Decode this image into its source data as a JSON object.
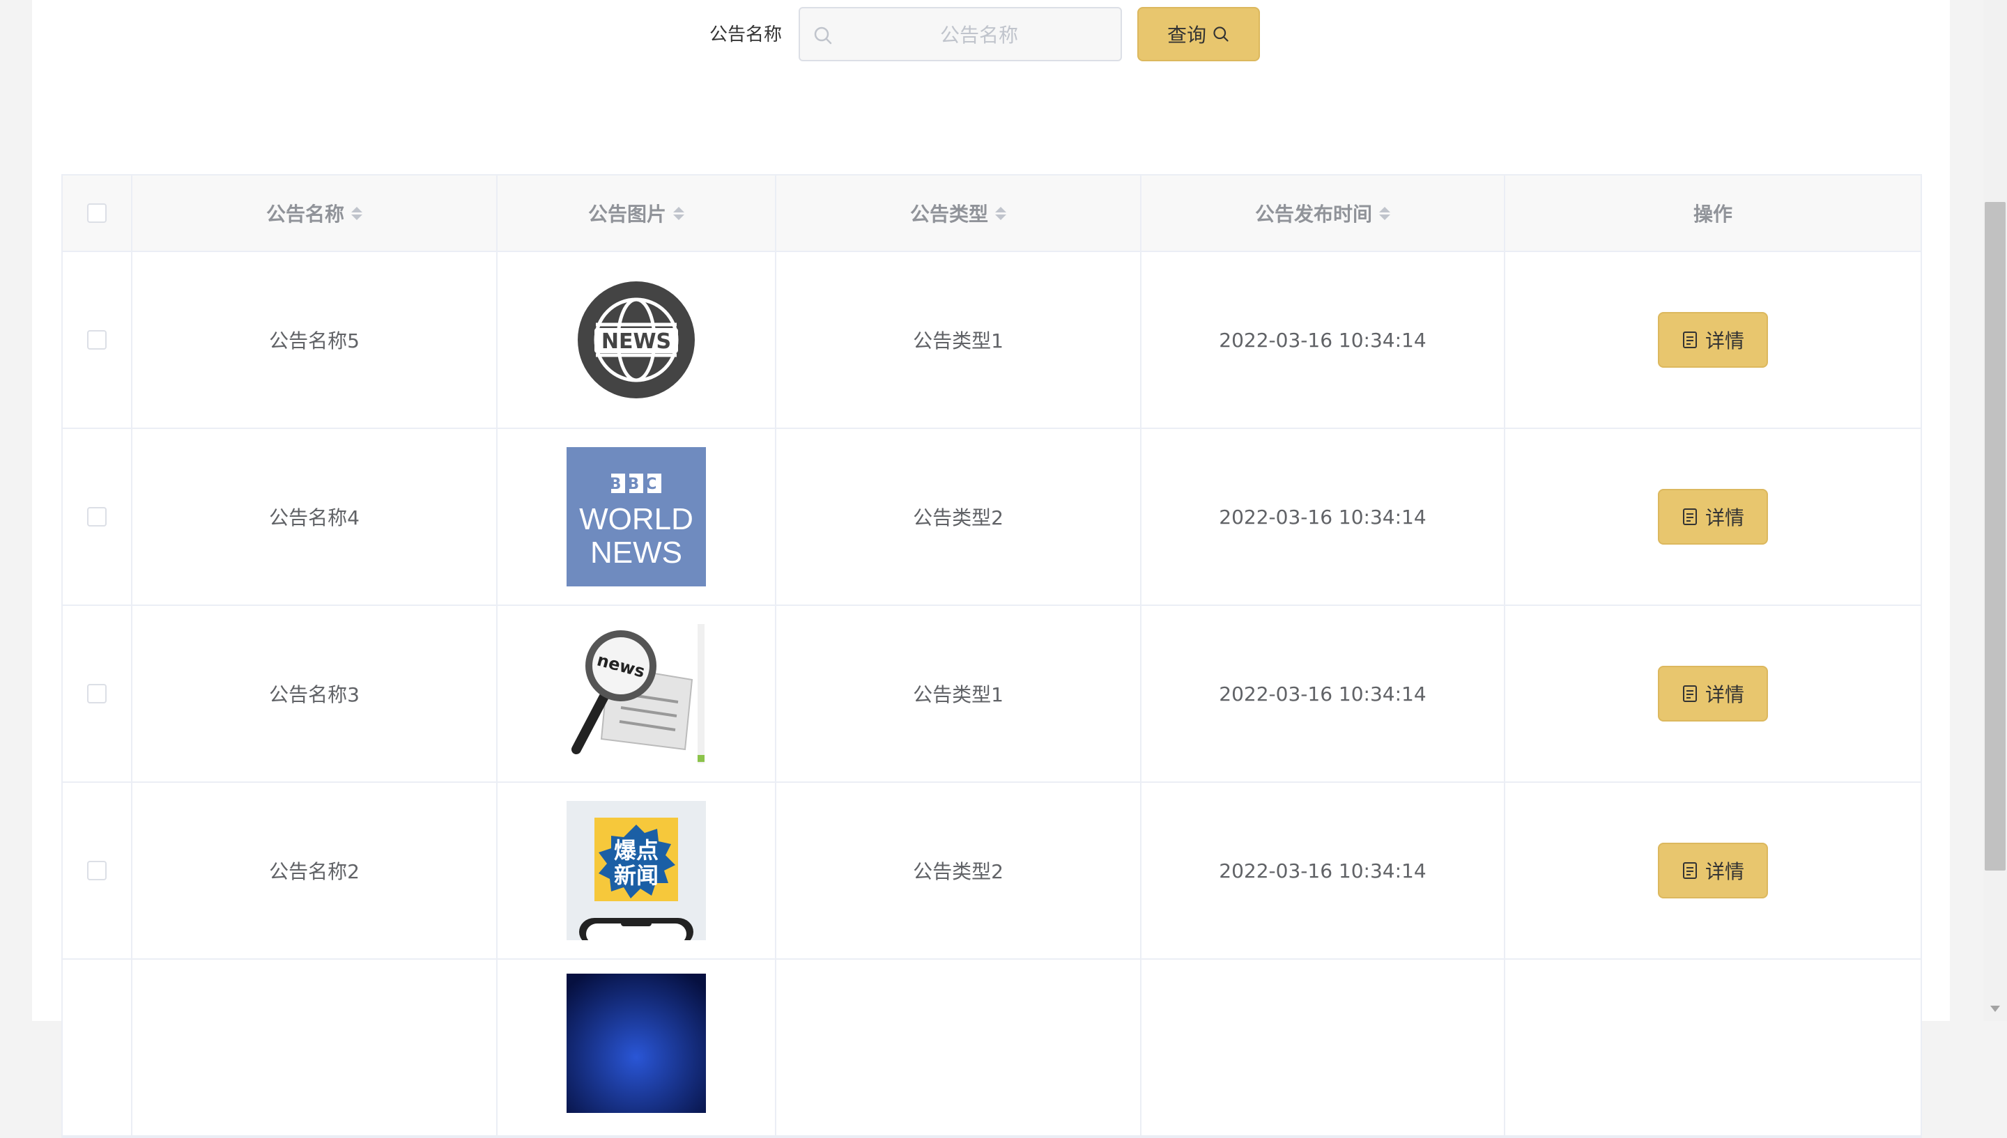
{
  "search": {
    "label": "公告名称",
    "placeholder": "公告名称",
    "button_label": "查询"
  },
  "table": {
    "headers": [
      "公告名称",
      "公告图片",
      "公告类型",
      "公告发布时间",
      "操作"
    ],
    "rows": [
      {
        "name": "公告名称5",
        "image": "news-globe-icon",
        "type": "公告类型1",
        "time": "2022-03-16 10:34:14",
        "action": "详情"
      },
      {
        "name": "公告名称4",
        "image": "bbc-world-news-logo",
        "type": "公告类型2",
        "time": "2022-03-16 10:34:14",
        "action": "详情"
      },
      {
        "name": "公告名称3",
        "image": "news-magnifier-image",
        "type": "公告类型1",
        "time": "2022-03-16 10:34:14",
        "action": "详情"
      },
      {
        "name": "公告名称2",
        "image": "breaking-news-phone-image",
        "type": "公告类型2",
        "time": "2022-03-16 10:34:14",
        "action": "详情"
      },
      {
        "name": "",
        "image": "blue-news-image",
        "type": "",
        "time": "",
        "action": ""
      }
    ],
    "image_texts": {
      "news_globe": "NEWS",
      "bbc": [
        "BBC",
        "WORLD",
        "NEWS"
      ],
      "magnifier": "news",
      "breaking": [
        "爆点",
        "新闻"
      ]
    }
  },
  "colors": {
    "accent": "#e8c66e",
    "accent_border": "#dcb85e",
    "border": "#ebeef5",
    "header_bg": "#f8f8f8"
  }
}
